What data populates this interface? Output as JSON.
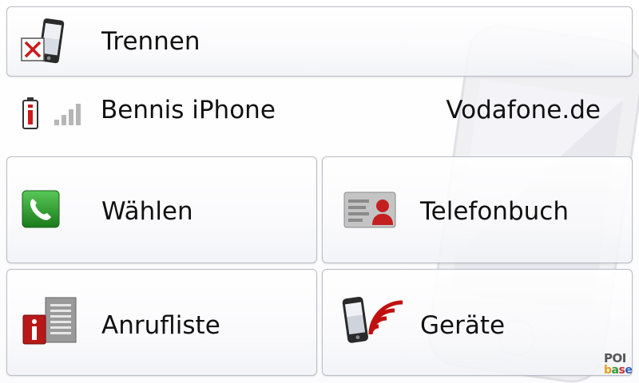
{
  "menu": {
    "disconnect": {
      "label": "Trennen",
      "icon": "phone-disconnect-icon"
    },
    "dial": {
      "label": "Wählen",
      "icon": "phone-handset-icon"
    },
    "phonebook": {
      "label": "Telefonbuch",
      "icon": "contact-card-icon"
    },
    "call_list": {
      "label": "Anrufliste",
      "icon": "call-list-info-icon"
    },
    "devices": {
      "label": "Geräte",
      "icon": "phone-wireless-icon"
    }
  },
  "status": {
    "device_name": "Bennis iPhone",
    "carrier": "Vodafone.de",
    "battery_icon": "battery-low-icon",
    "signal_icon": "signal-strength-icon",
    "signal_bars": 0
  },
  "watermark": {
    "line1": "POI",
    "line2_parts": [
      "b",
      "a",
      "s",
      "e"
    ]
  },
  "colors": {
    "battery_alert": "#d01818",
    "dial_green": "#2e9a2e",
    "contact_red": "#c42020",
    "info_red": "#b81818",
    "signal_wave_red": "#c01010"
  }
}
